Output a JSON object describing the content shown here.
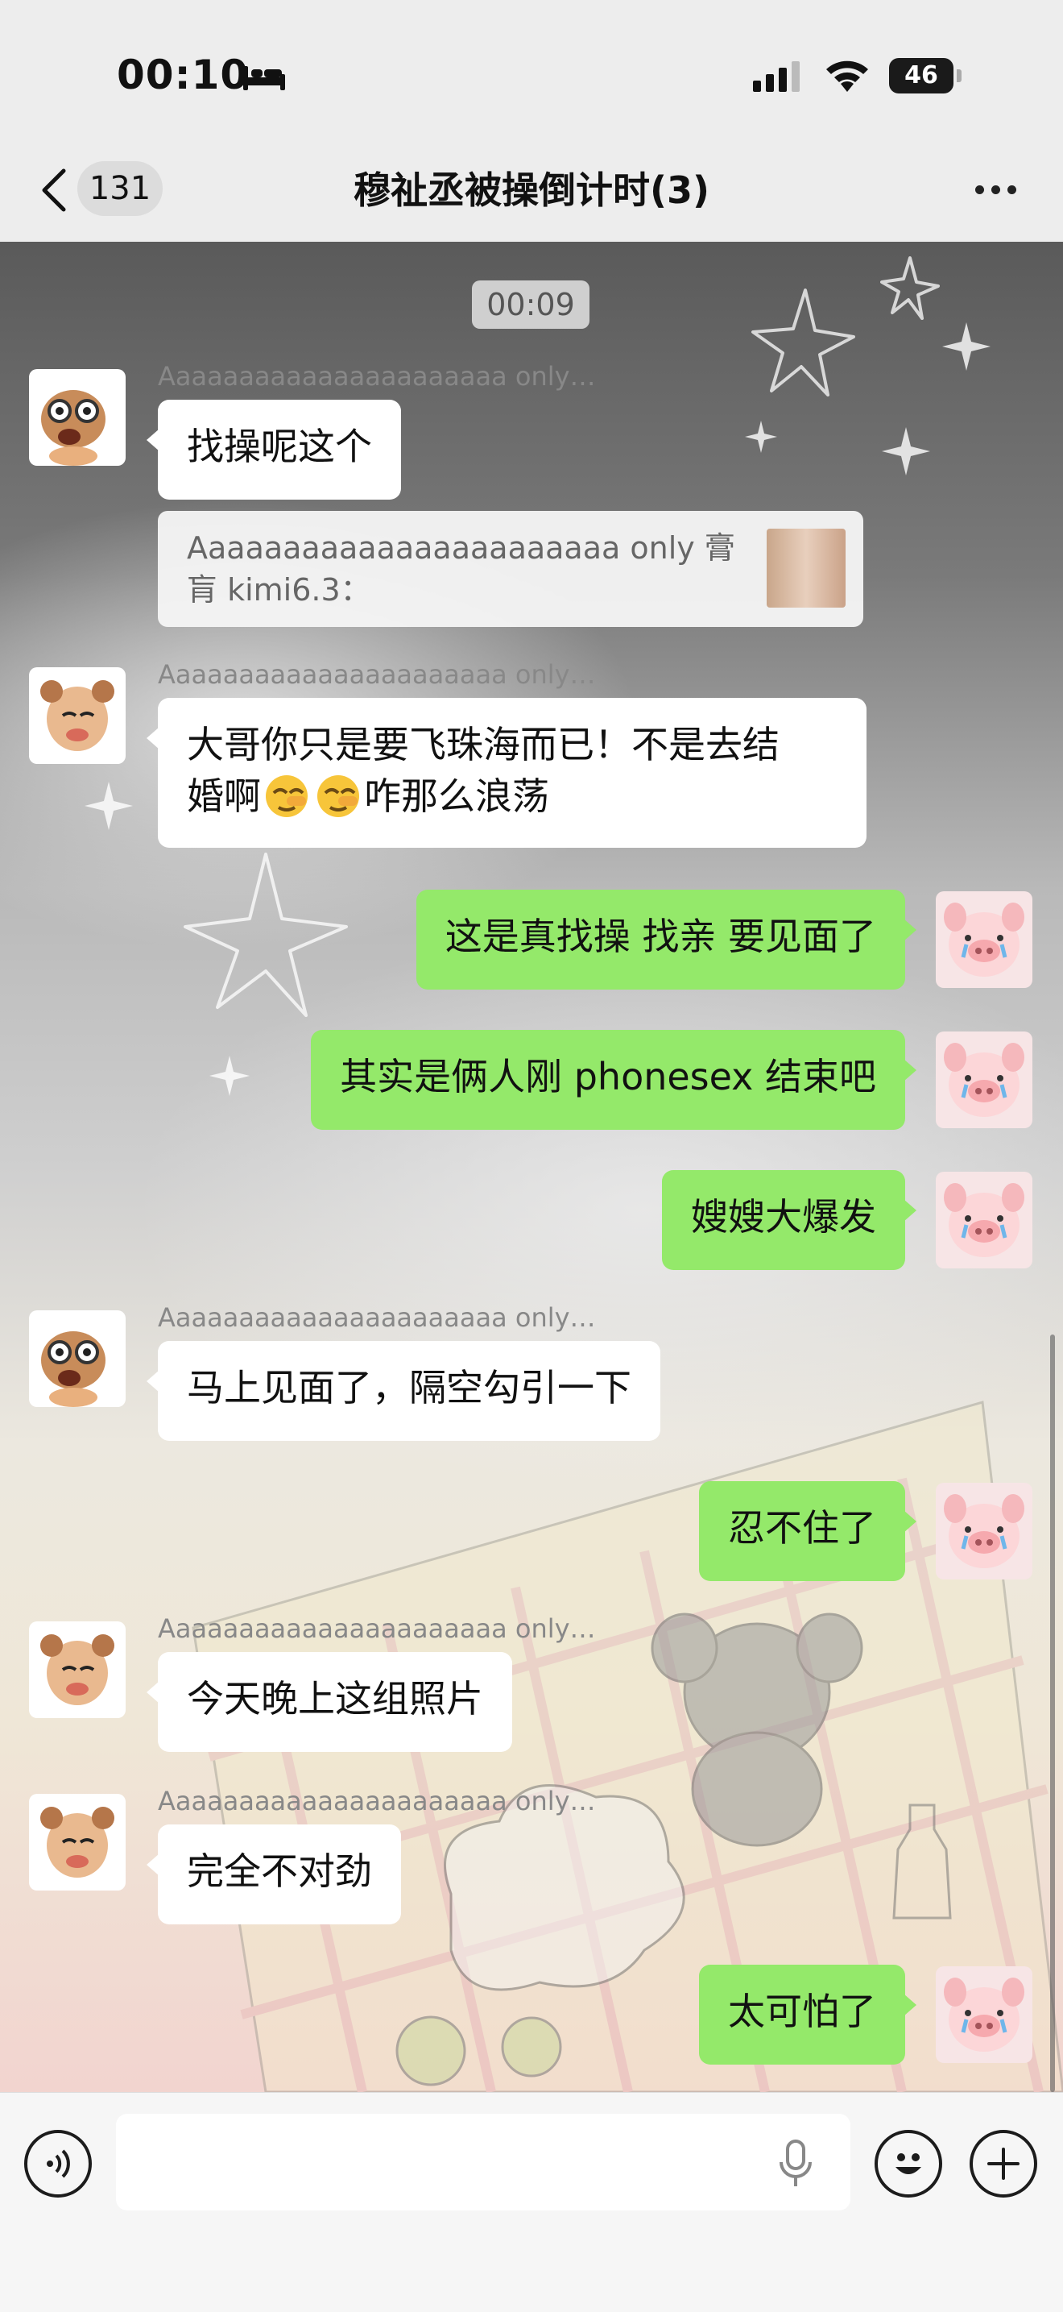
{
  "status_bar": {
    "time": "00:10",
    "battery": "46"
  },
  "nav": {
    "unread_count": "131",
    "title": "穆祉丞被操倒计时(3)"
  },
  "chat": {
    "timestamp": "00:09",
    "messages": [
      {
        "side": "in",
        "sender": "Aaaaaaaaaaaaaaaaaaaaaa only…",
        "text": "找操呢这个"
      },
      {
        "type": "quote",
        "text": "Aaaaaaaaaaaaaaaaaaaaaaa only 膏肓 kimi6.3："
      },
      {
        "side": "in",
        "sender": "Aaaaaaaaaaaaaaaaaaaaaa only…",
        "text_line1": "大哥你只是要飞珠海而已！不是去结",
        "text_line2_after_emoji": "咋那么浪荡"
      },
      {
        "side": "out",
        "text": "这是真找操 找亲 要见面了"
      },
      {
        "side": "out",
        "text": "其实是俩人刚 phonesex 结束吧"
      },
      {
        "side": "out",
        "text": "嫂嫂大爆发"
      },
      {
        "side": "in",
        "sender": "Aaaaaaaaaaaaaaaaaaaaaa only…",
        "text": "马上见面了，隔空勾引一下"
      },
      {
        "side": "out",
        "text": "忍不住了"
      },
      {
        "side": "in",
        "sender": "Aaaaaaaaaaaaaaaaaaaaaa only…",
        "text": "今天晚上这组照片"
      },
      {
        "side": "in",
        "sender": "Aaaaaaaaaaaaaaaaaaaaaa only…",
        "text": "完全不对劲"
      },
      {
        "side": "out",
        "text": "太可怕了"
      }
    ],
    "line2_prefix": "婚啊"
  },
  "input": {
    "placeholder": ""
  },
  "colors": {
    "outgoing_bubble": "#94e96a",
    "incoming_bubble": "#ffffff",
    "header_bg": "#ededed"
  }
}
